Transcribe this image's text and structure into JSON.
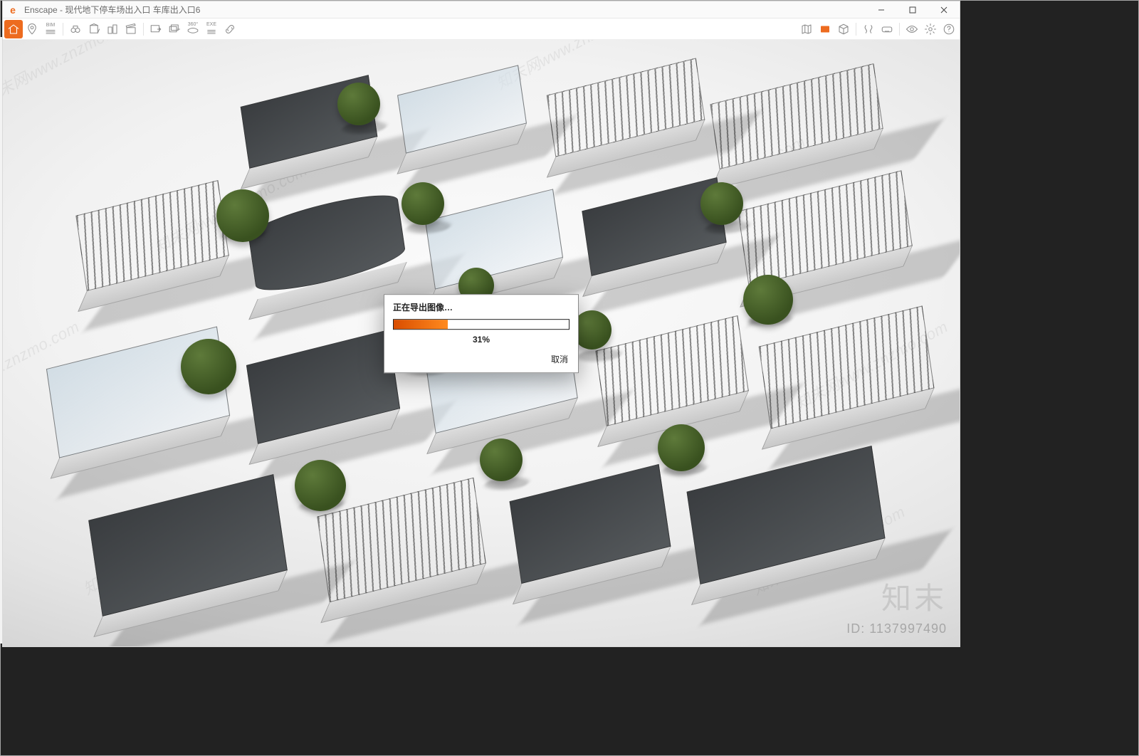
{
  "app": {
    "name": "Enscape",
    "title": "Enscape - 现代地下停车场出入口 车库出入口6"
  },
  "window_controls": {
    "minimize": "minimize",
    "maximize": "maximize",
    "close": "close"
  },
  "toolbar_left": [
    {
      "name": "home-icon",
      "title": "Home",
      "variant": "active"
    },
    {
      "name": "pin-icon",
      "title": "Favorites"
    },
    {
      "name": "bim-icon",
      "title": "BIM",
      "text": "BIM"
    },
    {
      "name": "binoculars-icon",
      "title": "Views"
    },
    {
      "name": "layers-icon",
      "title": "Create View"
    },
    {
      "name": "buildings-icon",
      "title": "Manage Views"
    },
    {
      "name": "clapper-icon",
      "title": "Video Path"
    },
    {
      "name": "export-img-icon",
      "title": "Export Image"
    },
    {
      "name": "export-batch-icon",
      "title": "Batch Export"
    },
    {
      "name": "pano-icon",
      "title": "360° Panorama",
      "text": "360°"
    },
    {
      "name": "exe-icon",
      "title": "Standalone EXE",
      "text": "EXE"
    },
    {
      "name": "link-icon",
      "title": "Web Standalone"
    }
  ],
  "toolbar_right": [
    {
      "name": "map-icon",
      "title": "Mini Map"
    },
    {
      "name": "safeframe-icon",
      "title": "Safe Frame",
      "variant": "highlight"
    },
    {
      "name": "cube-icon",
      "title": "Asset Library"
    },
    {
      "name": "compare-icon",
      "title": "Compare"
    },
    {
      "name": "vr-icon",
      "title": "VR Headset"
    },
    {
      "name": "eye-icon",
      "title": "Visual Settings"
    },
    {
      "name": "gear-icon",
      "title": "Settings"
    },
    {
      "name": "help-icon",
      "title": "Help"
    }
  ],
  "export_dialog": {
    "title": "正在导出图像…",
    "percent_value": 31,
    "percent_label": "31%",
    "cancel": "取消"
  },
  "watermark": {
    "text": "知末网www.znzmo.com",
    "brand": "知末",
    "id_label": "ID: 1137997490"
  },
  "colors": {
    "accent": "#ed6b1f"
  }
}
